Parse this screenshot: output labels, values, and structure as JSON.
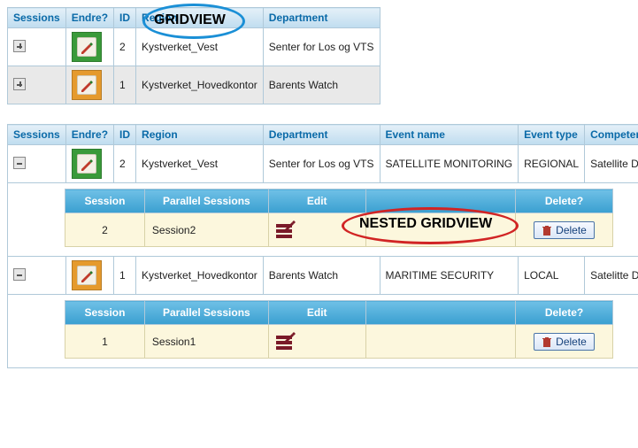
{
  "top_grid": {
    "headers": {
      "sessions": "Sessions",
      "endre": "Endre?",
      "id": "ID",
      "region": "Region",
      "department": "Department"
    },
    "rows": [
      {
        "id": "2",
        "region": "Kystverket_Vest",
        "department": "Senter for Los og VTS",
        "expanded": false,
        "edit_color": "green"
      },
      {
        "id": "1",
        "region": "Kystverket_Hovedkontor",
        "department": "Barents Watch",
        "expanded": false,
        "edit_color": "orange"
      }
    ]
  },
  "bottom_grid": {
    "headers": {
      "sessions": "Sessions",
      "endre": "Endre?",
      "id": "ID",
      "region": "Region",
      "department": "Department",
      "event_name": "Event name",
      "event_type": "Event type",
      "competence_area": "Competence Area"
    },
    "rows": [
      {
        "id": "2",
        "region": "Kystverket_Vest",
        "department": "Senter for Los og VTS",
        "event_name": "SATELLITE MONITORING",
        "event_type": "REGIONAL",
        "competence_area": "Satellite Design & Co",
        "expanded": true,
        "edit_color": "green",
        "nested": {
          "headers": {
            "session": "Session",
            "parallel": "Parallel Sessions",
            "edit": "Edit",
            "blank": "",
            "delete": "Delete?"
          },
          "row": {
            "session": "2",
            "parallel": "Session2",
            "delete_label": "Delete"
          }
        }
      },
      {
        "id": "1",
        "region": "Kystverket_Hovedkontor",
        "department": "Barents Watch",
        "event_name": "MARITIME SECURITY",
        "event_type": "LOCAL",
        "competence_area": "Satelitte Design",
        "expanded": true,
        "edit_color": "orange",
        "nested": {
          "headers": {
            "session": "Session",
            "parallel": "Parallel Sessions",
            "edit": "Edit",
            "blank": "",
            "delete": "Delete?"
          },
          "row": {
            "session": "1",
            "parallel": "Session1",
            "delete_label": "Delete"
          }
        }
      }
    ]
  },
  "annotations": {
    "top_label": "GRIDVIEW",
    "nested_label": "NESTED GRIDVIEW"
  }
}
